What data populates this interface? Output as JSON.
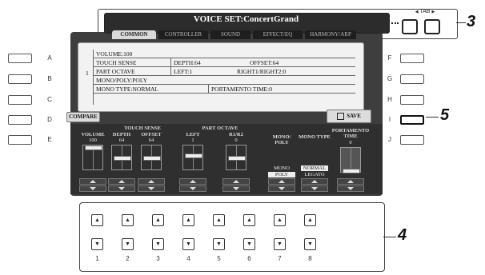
{
  "header": {
    "title": "VOICE SET:ConcertGrand",
    "tabs": [
      {
        "label": "COMMON",
        "active": true
      },
      {
        "label": "CONTROLLER",
        "active": false
      },
      {
        "label": "SOUND",
        "active": false
      },
      {
        "label": "EFFECT/EQ",
        "active": false
      },
      {
        "label": "HARMONY/ARP",
        "active": false
      }
    ]
  },
  "tab_nav": {
    "label": "TAB",
    "prev_icon": "triangle-left-icon",
    "next_icon": "triangle-right-icon"
  },
  "left_buttons": [
    "A",
    "B",
    "C",
    "D",
    "E"
  ],
  "right_buttons": [
    "F",
    "G",
    "H",
    "I",
    "J"
  ],
  "summary": {
    "volume": "VOLUME:100",
    "touch_sense": "TOUCH SENSE",
    "depth": "DEPTH:64",
    "offset": "OFFSET:64",
    "part_number": "1",
    "part_octave": "PART OCTAVE",
    "left": "LEFT:1",
    "right": "RIGHT1/RIGHT2:0",
    "mono_poly": "MONO/POLY:POLY",
    "mono_type": "MONO TYPE:NORMAL",
    "portamento": "PORTAMENTO TIME:0"
  },
  "buttons": {
    "compare": "COMPARE",
    "save": "SAVE",
    "save_icon": "floppy-disk-icon"
  },
  "group_labels": {
    "touch_sense": "TOUCH SENSE",
    "part_octave": "PART OCTAVE"
  },
  "params": [
    {
      "label": "VOLUME",
      "value": "100",
      "level": 1.0
    },
    {
      "label": "DEPTH",
      "value": "64",
      "level": 0.5
    },
    {
      "label": "OFFSET",
      "value": "64",
      "level": 0.5
    },
    {
      "label": "LEFT",
      "value": "1",
      "level": 0.6
    },
    {
      "label": "R1/R2",
      "value": "0",
      "level": 0.5
    },
    {
      "label": "MONO/ POLY",
      "options": [
        "MONO",
        "POLY"
      ],
      "selected": "POLY"
    },
    {
      "label": "MONO TYPE",
      "options": [
        "NORMAL",
        "LEGATO"
      ],
      "selected": "NORMAL"
    },
    {
      "label": "PORTAMENTO TIME",
      "value": "0",
      "level": 0.0
    }
  ],
  "hw_columns": [
    "1",
    "2",
    "3",
    "4",
    "5",
    "6",
    "7",
    "8"
  ],
  "callouts": {
    "c3": "3",
    "c4": "4",
    "c5": "5"
  }
}
